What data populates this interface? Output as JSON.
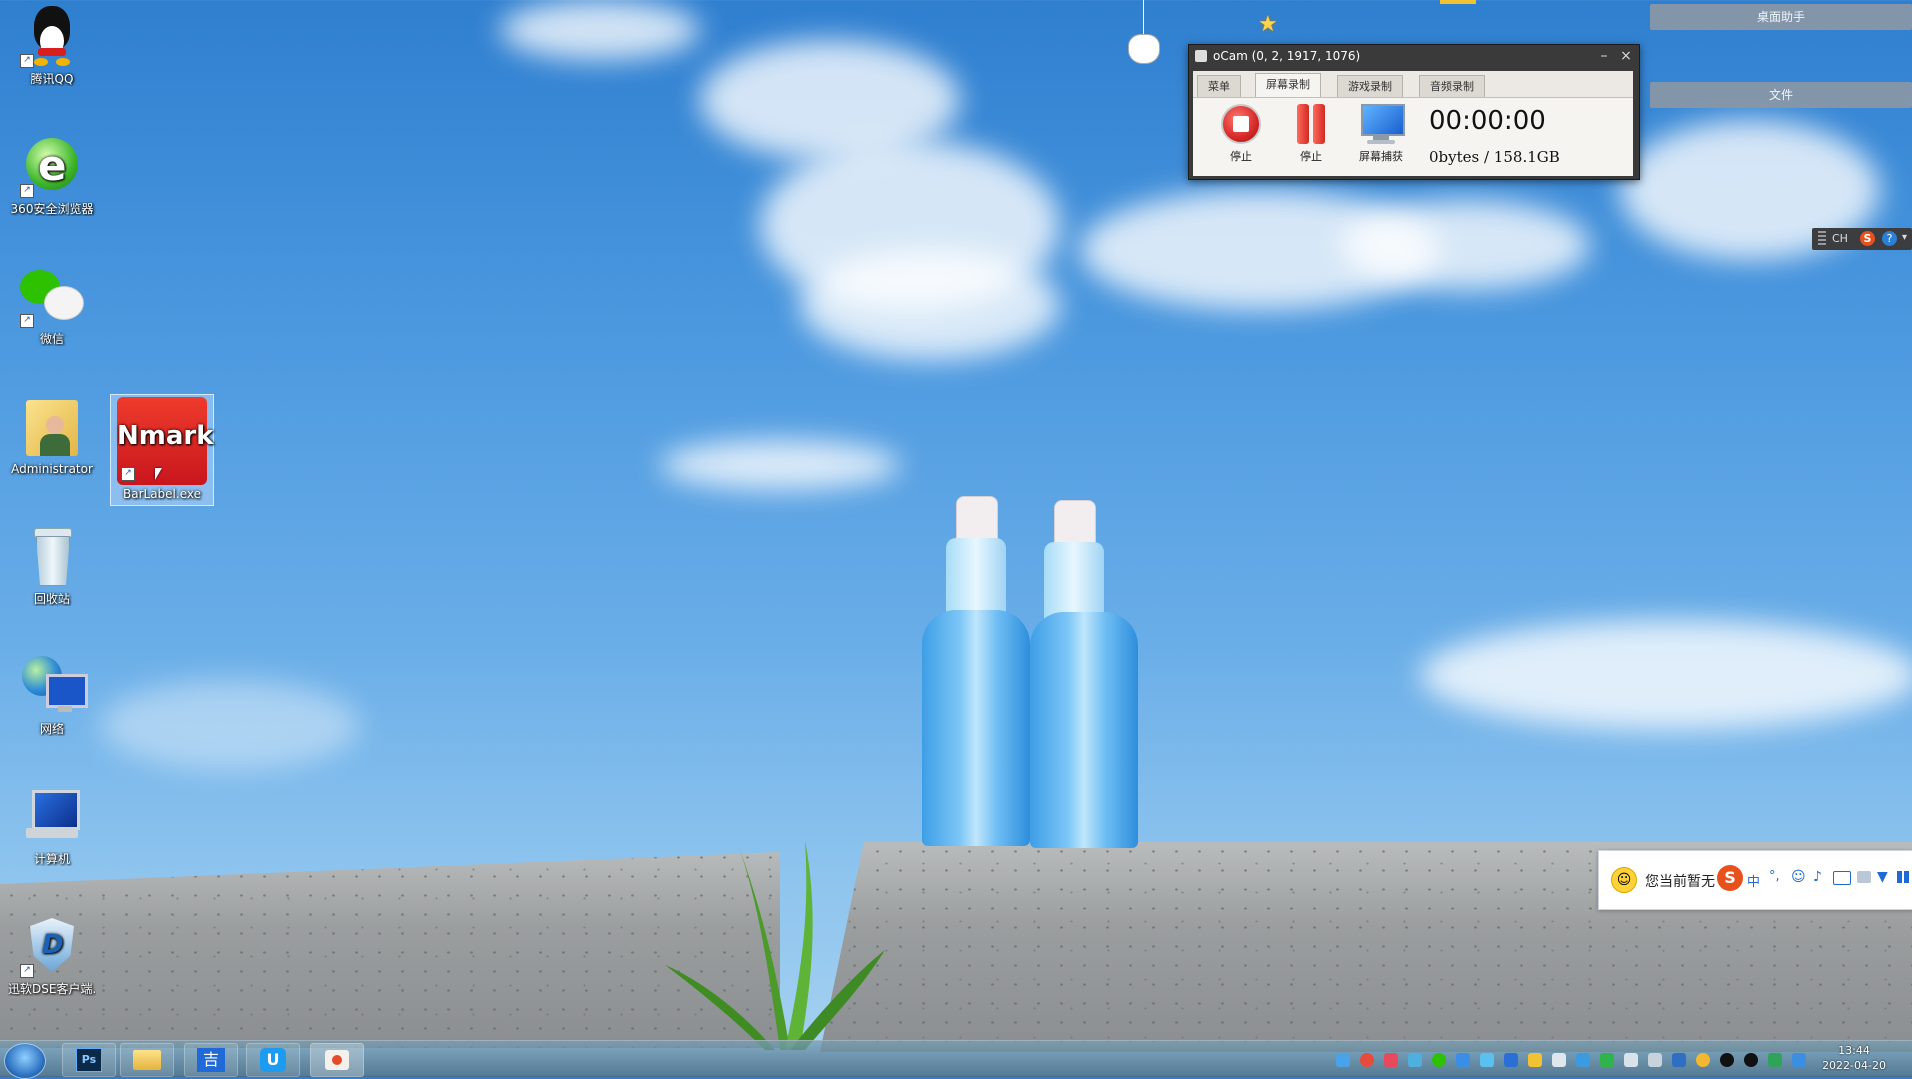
{
  "desktop": {
    "icons": [
      {
        "label": "腾讯QQ"
      },
      {
        "label": "360安全浏览器"
      },
      {
        "label": "微信"
      },
      {
        "label": "Administrator"
      },
      {
        "label": "BarLabel.exe",
        "logo_text": "Nmark"
      },
      {
        "label": "回收站"
      },
      {
        "label": "网络"
      },
      {
        "label": "计算机"
      },
      {
        "label": "迅软DSE客户端..."
      }
    ]
  },
  "ocam": {
    "title": "oCam (0, 2, 1917, 1076)",
    "tabs": [
      "菜单",
      "屏幕录制",
      "游戏录制",
      "音频录制"
    ],
    "active_tab": "屏幕录制",
    "buttons": {
      "stop": "停止",
      "pause": "停止",
      "capture": "屏幕捕获"
    },
    "timer": "00:00:00",
    "size": "0bytes / 158.1GB"
  },
  "assistant": {
    "title": "桌面助手",
    "files": "文件"
  },
  "ime": {
    "small_label": "CH",
    "status_text": "您当前暂无",
    "mode": "中"
  },
  "taskbar": {
    "time": "13:44",
    "date": "2022-04-20",
    "apps": [
      "start",
      "photoshop",
      "file-explorer",
      "app-blue",
      "app-u",
      "app-recorder"
    ]
  },
  "colors": {
    "sky": "#4b98df",
    "ocam_frame": "#3a3a3a",
    "stop_red": "#d62828",
    "assistant_bar": "#8a97a6"
  }
}
